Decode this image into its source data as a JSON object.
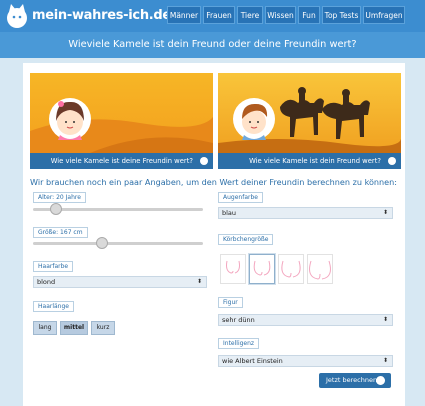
{
  "header": {
    "site_name": "mein-wahres-ich.de",
    "nav": [
      "Männer",
      "Frauen",
      "Tiere",
      "Wissen",
      "Fun",
      "Top Tests",
      "Umfragen"
    ]
  },
  "banner": {
    "title": "Wieviele Kamele ist dein Freund oder deine Freundin wert?"
  },
  "heroes": [
    {
      "caption": "Wie viele Kamele ist deine Freundin wert?"
    },
    {
      "caption": "Wie viele Kamele ist dein Freund wert?"
    }
  ],
  "form": {
    "intro": "Wir brauchen noch ein paar Angaben, um den Wert deiner Freundin berechnen zu können:",
    "age": {
      "label": "Alter: 20 Jahre",
      "value": 20
    },
    "height": {
      "label": "Größe: 167 cm",
      "value": 167
    },
    "hair_color": {
      "label": "Haarfarbe",
      "value": "blond"
    },
    "hair_length": {
      "label": "Haarlänge",
      "options": [
        "lang",
        "mittel",
        "kurz"
      ],
      "selected": "mittel"
    },
    "eye_color": {
      "label": "Augenfarbe",
      "value": "blau"
    },
    "bust": {
      "label": "Körbchengröße",
      "selected_index": 1
    },
    "figure": {
      "label": "Figur",
      "value": "sehr dünn"
    },
    "intelligence": {
      "label": "Intelligenz",
      "value": "wie Albert Einstein"
    },
    "submit_label": "Jetzt berechnen!"
  },
  "colors": {
    "header_blue": "#3c8dd0",
    "accent": "#2c6fa8",
    "page_bg": "#d7e8f3"
  }
}
